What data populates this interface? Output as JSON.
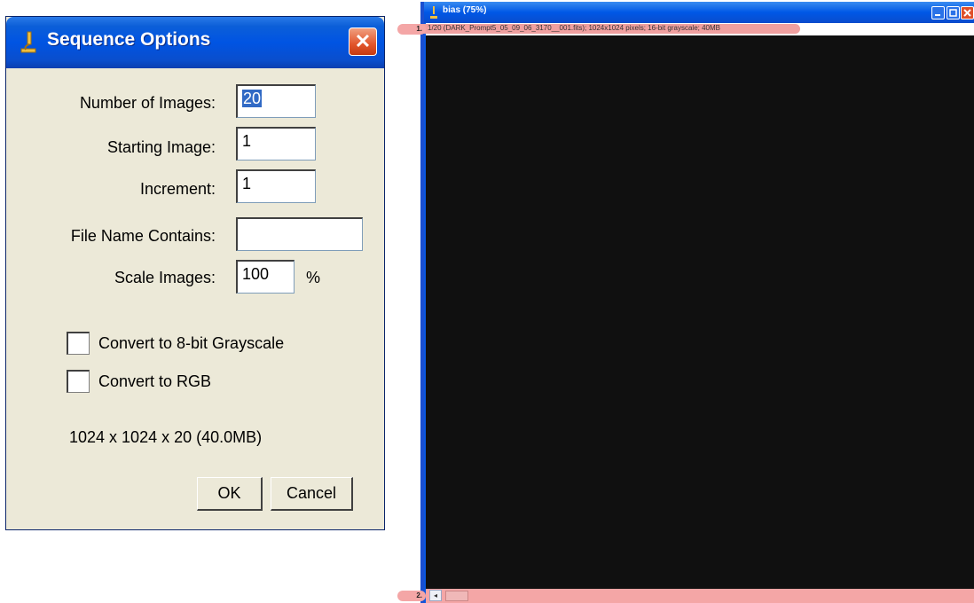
{
  "dialog": {
    "title": "Sequence Options",
    "close_label": "✕",
    "fields": [
      {
        "label": "Number of Images:",
        "value": "20"
      },
      {
        "label": "Starting Image:",
        "value": "1"
      },
      {
        "label": "Increment:",
        "value": "1"
      },
      {
        "label": "File Name Contains:",
        "value": ""
      },
      {
        "label": "Scale Images:",
        "value": "100",
        "suffix": "%"
      }
    ],
    "checkboxes": [
      {
        "label": "Convert to 8-bit Grayscale",
        "checked": false
      },
      {
        "label": "Convert to RGB",
        "checked": false
      }
    ],
    "size_info": "1024 x 1024 x 20 (40.0MB)",
    "ok_label": "OK",
    "cancel_label": "Cancel"
  },
  "image_window": {
    "title": "bias (75%)",
    "info": "1/20 (DARK_Prompt5_05_09_06_3170__001.fits); 1024x1024 pixels; 16-bit grayscale; 40MB",
    "markers": [
      "1.",
      "2."
    ],
    "scroll_left_glyph": "◂"
  },
  "colors": {
    "titlebar_blue": "#0054e3",
    "dialog_bg": "#ece9d8",
    "annotation_pink": "#f4a6a6",
    "canvas": "#101010"
  }
}
